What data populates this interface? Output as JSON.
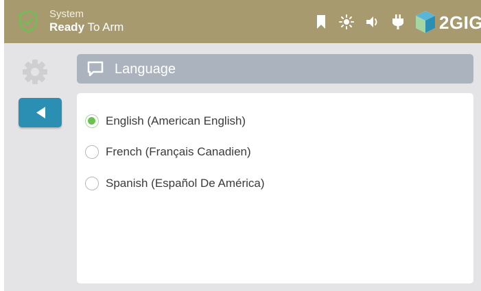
{
  "status": {
    "line1": "System",
    "line2_bold": "Ready",
    "line2_rest": " To Arm",
    "shield_icon": "shield-check-icon"
  },
  "top_icons": [
    "bookmark-icon",
    "brightness-icon",
    "volume-icon",
    "power-plug-icon"
  ],
  "brand": {
    "name": "2GIG",
    "logo_icon": "2gig-cube-logo"
  },
  "colors": {
    "topbar": "#a89a6f",
    "back_button": "#2b8eb3",
    "header_bar": "#aab3be",
    "radio_checked": "#6cc152"
  },
  "sidebar": {
    "settings_icon": "gear-icon",
    "back_icon": "back-arrow-icon"
  },
  "header": {
    "title": "Language",
    "icon": "chat-bubble-icon"
  },
  "options": [
    {
      "label": "English (American English)",
      "checked": true
    },
    {
      "label": "French (Français Canadien)",
      "checked": false
    },
    {
      "label": "Spanish (Español De América)",
      "checked": false
    }
  ]
}
